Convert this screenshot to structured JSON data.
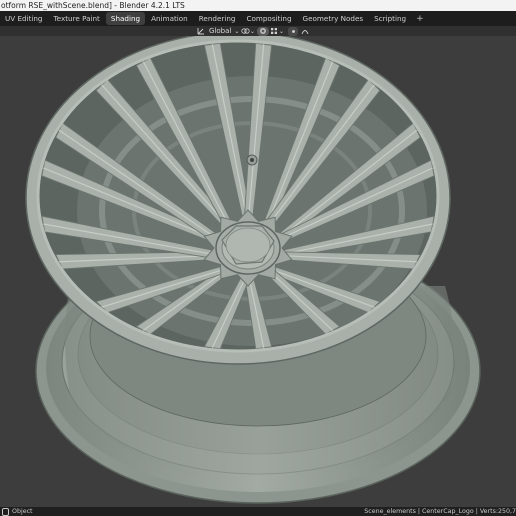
{
  "window": {
    "title": "otform RSE_withScene.blend] - Blender 4.2.1 LTS"
  },
  "tabs": [
    {
      "label": "UV Editing",
      "active": false
    },
    {
      "label": "Texture Paint",
      "active": false
    },
    {
      "label": "Shading",
      "active": true
    },
    {
      "label": "Animation",
      "active": false
    },
    {
      "label": "Rendering",
      "active": false
    },
    {
      "label": "Compositing",
      "active": false
    },
    {
      "label": "Geometry Nodes",
      "active": false
    },
    {
      "label": "Scripting",
      "active": false
    }
  ],
  "tab_add_label": "+",
  "toolbar": {
    "orientation_label": "Global",
    "orientation_icon": "transform-orientation-icon",
    "snap_icon": "snap-magnet-icon",
    "pivot_icon": "pivot-point-icon",
    "proportional_icon": "proportional-editing-icon",
    "falloff_icon": "falloff-curve-icon",
    "chevron": "⌄"
  },
  "viewport": {
    "object": "wheel-rim-model",
    "colors": {
      "background": "#3d3d3d",
      "rim": "#a9b0aa",
      "rim_dark": "#5f6762",
      "rim_light": "#c4cbc5"
    }
  },
  "statusbar": {
    "mode_icon": "mouse-icon",
    "mode_label": "Object",
    "right_text": "Scene_elements | CenterCap_Logo | Verts:250,7"
  }
}
